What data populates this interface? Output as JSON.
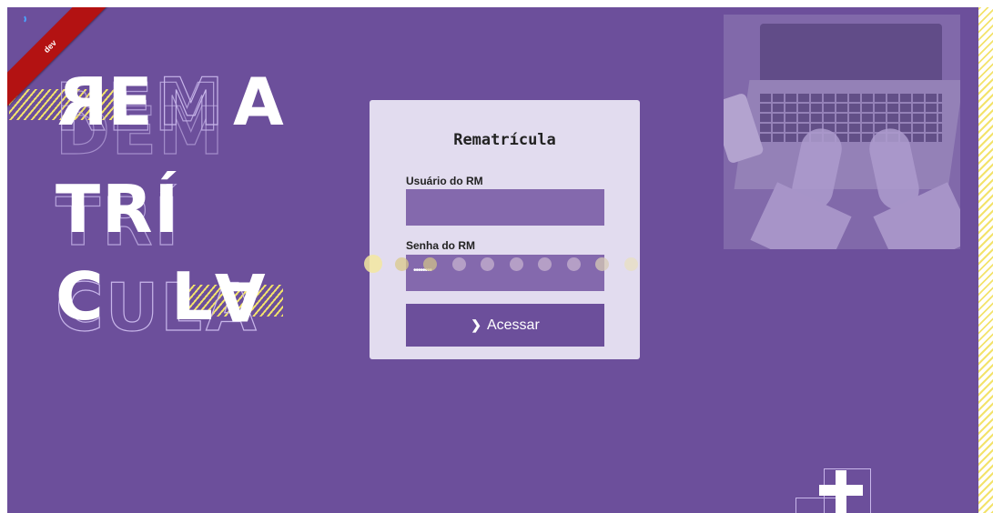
{
  "env": {
    "ribbon_label": "dev"
  },
  "hero": {
    "line1": {
      "solid": [
        "ʀE",
        "A"
      ],
      "outline": [
        "BEM",
        "DEM"
      ]
    },
    "line2": {
      "solid": "TRÍ",
      "outline": "TRÍ"
    },
    "line3": {
      "solid": [
        "C",
        "LⱯ"
      ],
      "outline": [
        "CULⱯ"
      ]
    }
  },
  "login": {
    "title": "Rematrícula",
    "user_label": "Usuário do RM",
    "user_value": "",
    "password_label": "Senha do RM",
    "password_value": "••••••••",
    "submit_label": "Acessar",
    "submit_icon": "chevron-right-icon"
  },
  "loader": {
    "dot_count": 10,
    "colors": [
      "#f3e8a0",
      "#d9c98a",
      "#cfc089",
      "#c5b2cf",
      "#c5b2cf",
      "#c5b2cf",
      "#c5b2cf",
      "#c5b2cf",
      "#d7cbb5",
      "#e8e0c0"
    ]
  },
  "colors": {
    "background": "#6c4f9b",
    "card": "#e2dcef",
    "field": "#8469ad",
    "accent": "#f3e36b",
    "ribbon": "#b31212"
  }
}
